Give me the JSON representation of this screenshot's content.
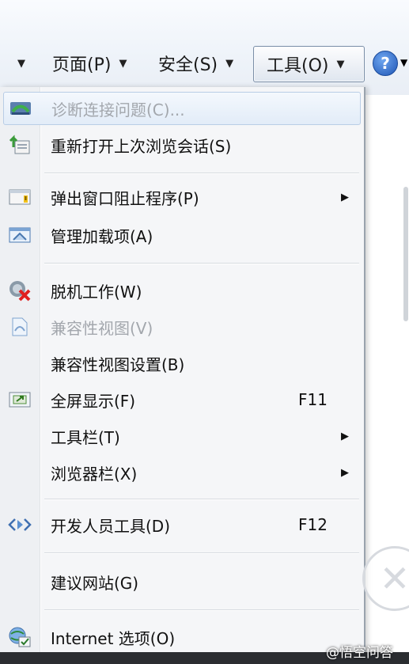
{
  "toolbar": {
    "items": [
      {
        "label": "",
        "arrow": "▼"
      },
      {
        "label": "页面(P)",
        "arrow": "▼"
      },
      {
        "label": "安全(S)",
        "arrow": "▼"
      },
      {
        "label": "工具(O)",
        "arrow": "▼"
      }
    ],
    "help": {
      "icon": "help-icon",
      "glyph": "?",
      "arrow": "▼"
    }
  },
  "menu": {
    "items": [
      {
        "label": "诊断连接问题(C)...",
        "icon": "diagnose-connection-icon",
        "disabled": true,
        "highlighted": true
      },
      {
        "label": "重新打开上次浏览会话(S)",
        "icon": "reopen-session-icon"
      },
      {
        "label": "弹出窗口阻止程序(P)",
        "icon": "popup-blocker-icon",
        "submenu": "▶"
      },
      {
        "label": "管理加载项(A)",
        "icon": "manage-addons-icon"
      },
      {
        "label": "脱机工作(W)",
        "icon": "work-offline-icon"
      },
      {
        "label": "兼容性视图(V)",
        "icon": "compatibility-view-icon",
        "disabled": true
      },
      {
        "label": "兼容性视图设置(B)",
        "icon": ""
      },
      {
        "label": "全屏显示(F)",
        "icon": "fullscreen-icon",
        "shortcut": "F11"
      },
      {
        "label": "工具栏(T)",
        "icon": "",
        "submenu": "▶"
      },
      {
        "label": "浏览器栏(X)",
        "icon": "",
        "submenu": "▶"
      },
      {
        "label": "开发人员工具(D)",
        "icon": "developer-tools-icon",
        "shortcut": "F12"
      },
      {
        "label": "建议网站(G)",
        "icon": ""
      },
      {
        "label": "Internet 选项(O)",
        "icon": "internet-options-icon"
      }
    ]
  },
  "overlay": {
    "close_glyph": "✕",
    "watermark": "@悟空问答"
  },
  "colors": {
    "menu_bg": "#f5f6f8",
    "highlight": "#e2ecf8",
    "disabled_text": "#a3a7ad"
  }
}
